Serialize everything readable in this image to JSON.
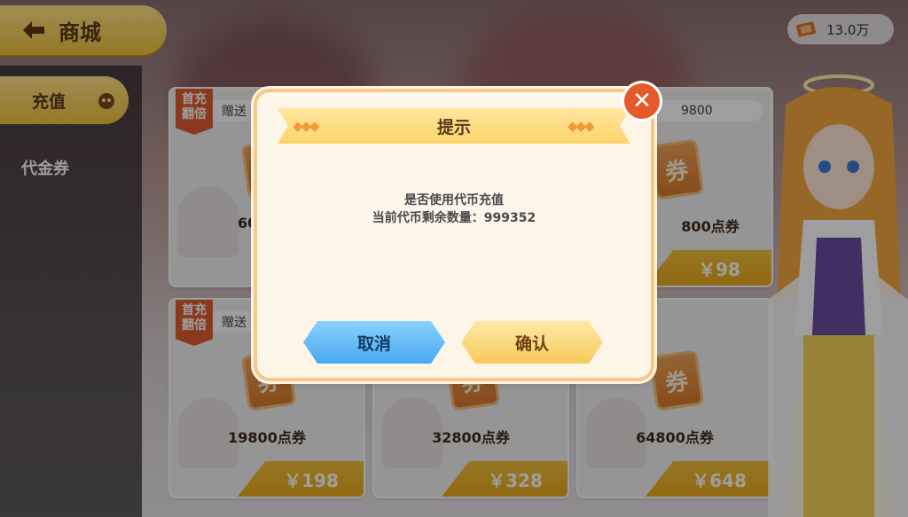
{
  "header": {
    "back_label": "商城",
    "back_icon": "arrow-left-icon"
  },
  "currency": {
    "icon": "ticket-icon",
    "value": "13.0万"
  },
  "sidebar": {
    "items": [
      {
        "label": "充值",
        "selected": true,
        "icon": "bag-icon"
      },
      {
        "label": "代金券",
        "selected": false
      }
    ]
  },
  "cards": [
    {
      "badge": "首充\n翻倍",
      "gift": "赠送",
      "points": "60",
      "price": ""
    },
    {
      "gift": "",
      "points": "",
      "price": ""
    },
    {
      "gift": "9800",
      "points": "800点券",
      "price": "￥98"
    },
    {
      "badge": "首充\n翻倍",
      "gift": "赠送",
      "points": "19800点券",
      "price": "￥198"
    },
    {
      "gift": "",
      "points": "32800点券",
      "price": "￥328"
    },
    {
      "gift": "",
      "points": "64800点券",
      "price": "￥648"
    }
  ],
  "coupon_label": "券",
  "dialog": {
    "title": "提示",
    "line1": "是否使用代币充值",
    "line2": "当前代币剩余数量：999352",
    "cancel": "取消",
    "confirm": "确认",
    "close_icon": "close-icon"
  },
  "colors": {
    "accent_gold": "#f3c23b",
    "close_red": "#e45a2b",
    "cancel_blue": "#4aa8ee"
  }
}
